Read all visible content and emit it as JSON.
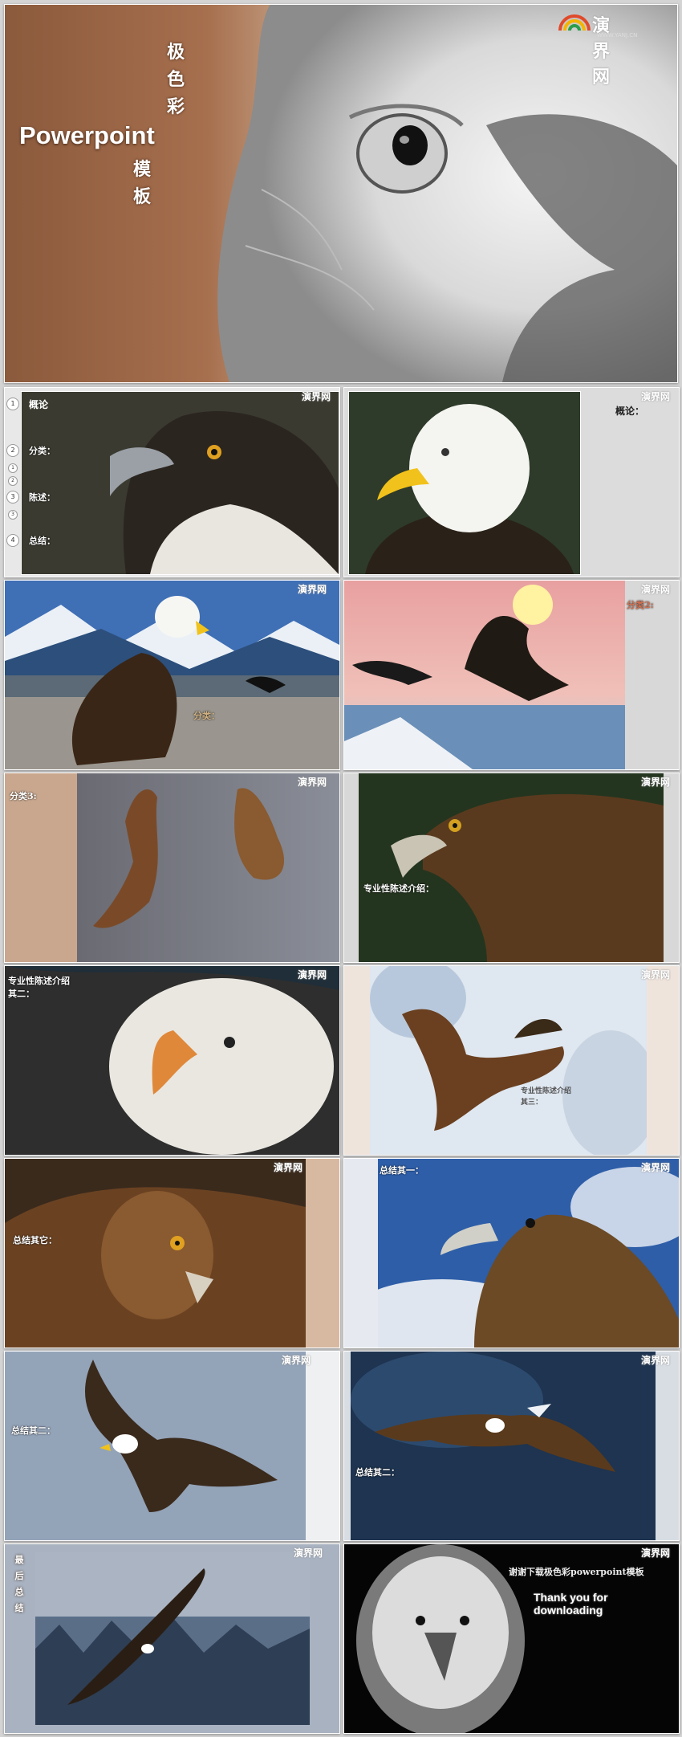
{
  "brand": {
    "name": "演界网",
    "url": "WWW.YANJ.CN"
  },
  "hero": {
    "title": "Powerpoint",
    "vertical_top": [
      "极",
      "色",
      "彩"
    ],
    "vertical_bottom": [
      "模",
      "板"
    ]
  },
  "slide2": {
    "items": [
      {
        "num": "1",
        "label": "概论"
      },
      {
        "num": "2",
        "label": "分类："
      },
      {
        "num": "3",
        "label": "陈述："
      },
      {
        "num": "4",
        "label": "总结："
      }
    ],
    "sub_nums": [
      "1",
      "2",
      "3",
      "4",
      "5"
    ]
  },
  "slide3": {
    "label": "概论："
  },
  "slide4": {
    "label": "分类："
  },
  "slide5": {
    "label": "分类2:"
  },
  "slide6": {
    "label": "分类3:"
  },
  "slide7": {
    "label": "专业性陈述介绍："
  },
  "slide8": {
    "label_l1": "专业性陈述介绍",
    "label_l2": "其二："
  },
  "slide9": {
    "label_l1": "专业性陈述介绍",
    "label_l2": "其三："
  },
  "slide10": {
    "label": "总结其它："
  },
  "slide11": {
    "label": "总结其一："
  },
  "slide12": {
    "label": "总结其二："
  },
  "slide13": {
    "label": "总结其二："
  },
  "slide14": {
    "vertical": [
      "最",
      "后",
      "总",
      "结"
    ]
  },
  "slide15": {
    "thanks_cn": "谢谢下载极色彩powerpoint模板",
    "thanks_en": "Thank you for downloading"
  },
  "colors": {
    "bg": "#d4d4d4",
    "brown": "#8a5a3c",
    "tan": "#c8a78e"
  }
}
